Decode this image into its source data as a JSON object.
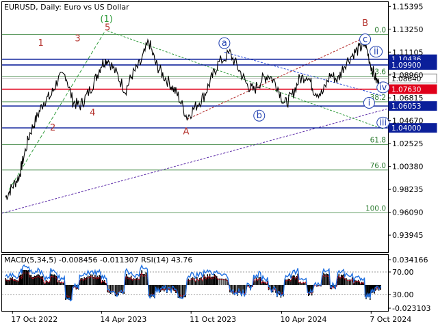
{
  "chart_data": {
    "type": "line",
    "title": "EURUSD, Daily:  Euro vs US Dollar",
    "y_ticks": [
      "1.15395",
      "1.13250",
      "1.11105",
      "1.08960",
      "1.06815",
      "1.04670",
      "1.02525",
      "1.00380",
      "0.98235",
      "0.96090",
      "0.93945"
    ],
    "x_ticks": [
      "17 Oct 2022",
      "14 Apr 2023",
      "11 Oct 2023",
      "10 Apr 2024",
      "7 Oct 2024"
    ],
    "price": {
      "x": [
        "2022-10-03",
        "2022-10-17",
        "2022-10-31",
        "2022-11-07",
        "2022-11-21",
        "2022-12-05",
        "2022-12-19",
        "2023-01-02",
        "2023-01-16",
        "2023-02-01",
        "2023-02-15",
        "2023-03-01",
        "2023-03-15",
        "2023-04-01",
        "2023-04-14",
        "2023-04-26",
        "2023-05-15",
        "2023-06-01",
        "2023-06-15",
        "2023-07-01",
        "2023-07-18",
        "2023-08-01",
        "2023-08-15",
        "2023-09-01",
        "2023-09-15",
        "2023-10-03",
        "2023-10-20",
        "2023-11-06",
        "2023-11-20",
        "2023-12-04",
        "2023-12-28",
        "2024-01-15",
        "2024-02-01",
        "2024-02-14",
        "2024-03-01",
        "2024-03-15",
        "2024-04-01",
        "2024-04-16",
        "2024-05-01",
        "2024-05-15",
        "2024-06-01",
        "2024-06-14",
        "2024-07-01",
        "2024-07-17",
        "2024-08-01",
        "2024-08-15",
        "2024-09-02",
        "2024-09-16",
        "2024-09-25",
        "2024-10-07",
        "2024-10-17",
        "2024-10-28"
      ],
      "y": [
        0.975,
        0.985,
        0.995,
        1.01,
        1.035,
        1.05,
        1.065,
        1.07,
        1.085,
        1.09,
        1.065,
        1.06,
        1.07,
        1.085,
        1.1,
        1.105,
        1.09,
        1.075,
        1.09,
        1.1,
        1.121,
        1.1,
        1.09,
        1.08,
        1.07,
        1.05,
        1.06,
        1.07,
        1.085,
        1.1,
        1.11,
        1.095,
        1.08,
        1.075,
        1.085,
        1.09,
        1.08,
        1.062,
        1.07,
        1.085,
        1.09,
        1.075,
        1.072,
        1.09,
        1.085,
        1.1,
        1.11,
        1.115,
        1.119,
        1.098,
        1.085,
        1.078
      ]
    },
    "horizontal_levels": [
      {
        "value": 1.10436,
        "label": "1.10436",
        "color": "#0b1f9a"
      },
      {
        "value": 1.099,
        "label": "1.09900",
        "color": "#0b1f9a"
      },
      {
        "value": 1.0864,
        "label": "1.08640",
        "color": "#ffffff",
        "text_color": "#000000"
      },
      {
        "value": 1.0763,
        "label": "1.07630",
        "color": "#e0001a"
      },
      {
        "value": 1.06053,
        "label": "1.06053",
        "color": "#0b1f9a"
      },
      {
        "value": 1.04,
        "label": "1.04000",
        "color": "#0b1f9a"
      }
    ],
    "fibonacci": {
      "color": "#2e7d32",
      "levels": [
        {
          "label": "0.0",
          "value": 1.1275
        },
        {
          "label": "23.6",
          "value": 1.0885
        },
        {
          "label": "38.2",
          "value": 1.0645
        },
        {
          "label": "61.8",
          "value": 1.0245
        },
        {
          "label": "76.0",
          "value": 1.0005
        },
        {
          "label": "100.0",
          "value": 0.9605
        }
      ]
    },
    "wave_labels": {
      "red": [
        {
          "label": "1",
          "x": "2022-12-13",
          "y": 1.117
        },
        {
          "label": "2",
          "x": "2023-01-06",
          "y": 1.0375
        },
        {
          "label": "3",
          "x": "2023-02-25",
          "y": 1.121
        },
        {
          "label": "4",
          "x": "2023-03-27",
          "y": 1.0515
        },
        {
          "label": "5",
          "x": "2023-04-26",
          "y": 1.1315
        },
        {
          "label": "A",
          "x": "2023-10-01",
          "y": 1.034
        },
        {
          "label": "B",
          "x": "2024-09-25",
          "y": 1.1355
        }
      ],
      "green": [
        {
          "label": "(1)",
          "x": "2023-04-24",
          "y": 1.1395
        }
      ],
      "blue_circled": [
        {
          "label": "a",
          "x": "2023-12-17",
          "y": 1.1195
        },
        {
          "label": "b",
          "x": "2024-02-25",
          "y": 1.0515
        },
        {
          "label": "c",
          "x": "2024-09-25",
          "y": 1.123
        },
        {
          "label": "i",
          "x": "2024-10-03",
          "y": 1.0635
        },
        {
          "label": "ii",
          "x": "2024-10-17",
          "y": 1.1115
        },
        {
          "label": "iii",
          "x": "2024-10-31",
          "y": 1.045
        },
        {
          "label": "iv",
          "x": "2024-10-31",
          "y": 1.078
        }
      ]
    },
    "indicator": {
      "title": "MACD(5,34,5) -0.008456 -0.011307 RSI(14) 43.76",
      "y_ticks": [
        "0.034166",
        "70.00",
        "30.00",
        "-0.023103"
      ],
      "colors": {
        "histogram": "#000000",
        "rsi": "#1e6fe0",
        "signal": "#e0001a"
      }
    },
    "colors": {
      "price": "#000000",
      "fib": "#2e7d32",
      "trend_green": "#2e9b3a",
      "trend_purple": "#5b2aa8",
      "trend_red": "#b22222"
    }
  }
}
